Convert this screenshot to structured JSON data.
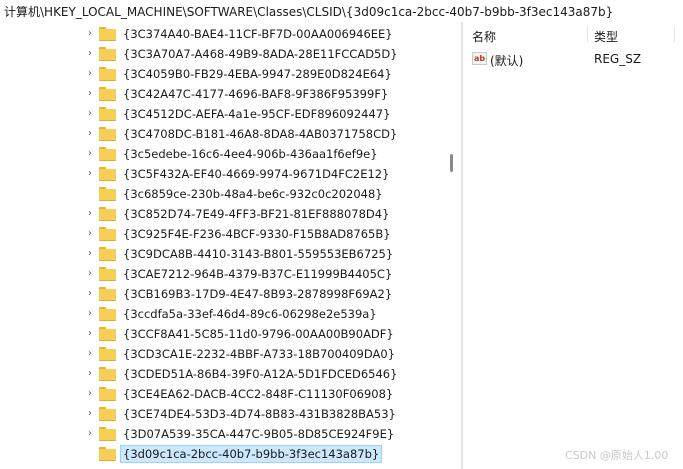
{
  "address_bar": {
    "path": "计算机\\HKEY_LOCAL_MACHINE\\SOFTWARE\\Classes\\CLSID\\{3d09c1ca-2bcc-40b7-b9bb-3f3ec143a87b}"
  },
  "tree": {
    "items": [
      {
        "label": "{3C374A40-BAE4-11CF-BF7D-00AA006946EE}",
        "twisty": "›"
      },
      {
        "label": "{3C3A70A7-A468-49B9-8ADA-28E11FCCAD5D}",
        "twisty": "›"
      },
      {
        "label": "{3C4059B0-FB29-4EBA-9947-289E0D824E64}",
        "twisty": "›"
      },
      {
        "label": "{3C42A47C-4177-4696-BAF8-9F386F95399F}",
        "twisty": "›"
      },
      {
        "label": "{3C4512DC-AEFA-4a1e-95CF-EDF896092447}",
        "twisty": "›"
      },
      {
        "label": "{3C4708DC-B181-46A8-8DA8-4AB0371758CD}",
        "twisty": "›"
      },
      {
        "label": "{3c5edebe-16c6-4ee4-906b-436aa1f6ef9e}",
        "twisty": "›"
      },
      {
        "label": "{3C5F432A-EF40-4669-9974-9671D4FC2E12}",
        "twisty": "›"
      },
      {
        "label": "{3c6859ce-230b-48a4-be6c-932c0c202048}",
        "twisty": ""
      },
      {
        "label": "{3C852D74-7E49-4FF3-BF21-81EF888078D4}",
        "twisty": "›"
      },
      {
        "label": "{3C925F4E-F236-4BCF-9330-F15B8AD8765B}",
        "twisty": "›"
      },
      {
        "label": "{3C9DCA8B-4410-3143-B801-559553EB6725}",
        "twisty": "›"
      },
      {
        "label": "{3CAE7212-964B-4379-B37C-E11999B4405C}",
        "twisty": "›"
      },
      {
        "label": "{3CB169B3-17D9-4E47-8B93-2878998F69A2}",
        "twisty": "›"
      },
      {
        "label": "{3ccdfa5a-33ef-46d4-89c6-06298e2e539a}",
        "twisty": "›"
      },
      {
        "label": "{3CCF8A41-5C85-11d0-9796-00AA00B90ADF}",
        "twisty": "›"
      },
      {
        "label": "{3CD3CA1E-2232-4BBF-A733-18B700409DA0}",
        "twisty": "›"
      },
      {
        "label": "{3CDED51A-86B4-39F0-A12A-5D1FDCED6546}",
        "twisty": "›"
      },
      {
        "label": "{3CE4EA62-DACB-4CC2-848F-C11130F06908}",
        "twisty": "›"
      },
      {
        "label": "{3CE74DE4-53D3-4D74-8B83-431B3828BA53}",
        "twisty": "›"
      },
      {
        "label": "{3D07A539-35CA-447C-9B05-8D85CE924F9E}",
        "twisty": "›"
      },
      {
        "label": "{3d09c1ca-2bcc-40b7-b9bb-3f3ec143a87b}",
        "twisty": "",
        "selected": true
      }
    ]
  },
  "list": {
    "headers": {
      "name": "名称",
      "type": "类型"
    },
    "rows": [
      {
        "icon": "ab",
        "name": "(默认)",
        "type": "REG_SZ"
      }
    ]
  },
  "watermark": "CSDN @原始人1.00",
  "colors": {
    "selection": "#cce8ff",
    "folder": "#f7cf56"
  }
}
